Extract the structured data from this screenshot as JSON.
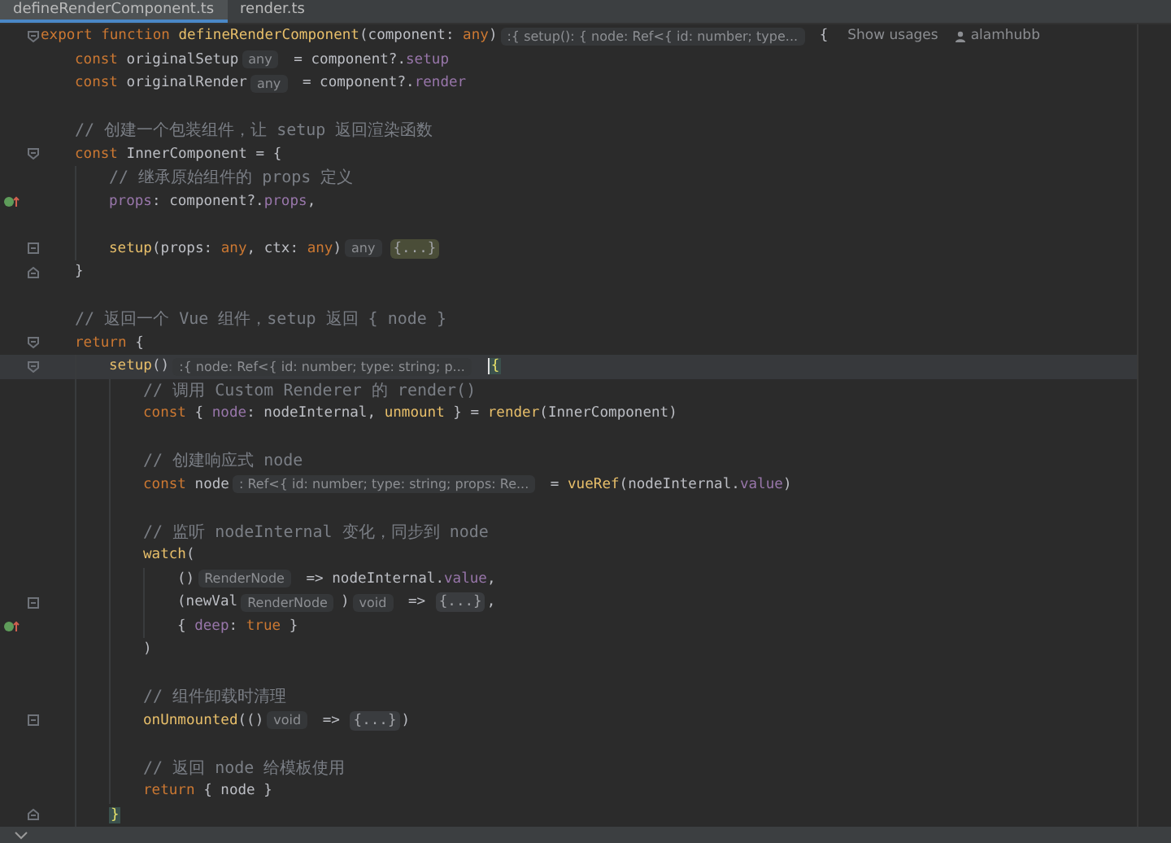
{
  "tabs": [
    {
      "label": "defineRenderComponent.ts",
      "selected": true
    },
    {
      "label": "render.ts",
      "selected": false
    }
  ],
  "lines": [
    {
      "kind": "code",
      "current": false,
      "gutter": {
        "kind": "fold"
      },
      "tokens": [
        {
          "kind": "kw",
          "text": "export function "
        },
        {
          "kind": "fn",
          "text": "defineRenderComponent"
        },
        {
          "kind": "plain",
          "text": "(component: "
        },
        {
          "kind": "kw",
          "text": "any"
        },
        {
          "kind": "plain",
          "text": ")"
        },
        {
          "kind": "hint",
          "text": ":{ setup(): { node: Ref<{ id: number; type..."
        },
        {
          "kind": "plain",
          "text": " {"
        },
        {
          "kind": "usages",
          "text": "Show usages"
        },
        {
          "kind": "author",
          "text": "alamhubb"
        }
      ],
      "children": [
        {
          "kind": "code",
          "current": false,
          "tokens": [
            {
              "kind": "kw",
              "text": "const "
            },
            {
              "kind": "plain",
              "text": "originalSetup"
            },
            {
              "kind": "hint",
              "text": "any"
            },
            {
              "kind": "plain",
              "text": " = component?."
            },
            {
              "kind": "prop",
              "text": "setup"
            }
          ]
        },
        {
          "kind": "code",
          "current": false,
          "tokens": [
            {
              "kind": "kw",
              "text": "const "
            },
            {
              "kind": "plain",
              "text": "originalRender"
            },
            {
              "kind": "hint",
              "text": "any"
            },
            {
              "kind": "plain",
              "text": " = component?."
            },
            {
              "kind": "prop",
              "text": "render"
            }
          ]
        },
        {
          "kind": "blank"
        },
        {
          "kind": "code",
          "current": false,
          "tokens": [
            {
              "kind": "comment",
              "text": "// 创建一个包装组件，让 setup 返回渲染函数"
            }
          ]
        },
        {
          "kind": "code",
          "current": false,
          "gutter": {
            "kind": "fold"
          },
          "tokens": [
            {
              "kind": "kw",
              "text": "const "
            },
            {
              "kind": "plain",
              "text": "InnerComponent = {"
            }
          ],
          "children": [
            {
              "kind": "code",
              "current": false,
              "tokens": [
                {
                  "kind": "comment",
                  "text": "// 继承原始组件的 props 定义"
                }
              ]
            },
            {
              "kind": "code",
              "current": false,
              "gutter": {
                "kind": "implement"
              },
              "tokens": [
                {
                  "kind": "prop",
                  "text": "props"
                },
                {
                  "kind": "plain",
                  "text": ": component?."
                },
                {
                  "kind": "prop",
                  "text": "props"
                },
                {
                  "kind": "plain",
                  "text": ","
                }
              ]
            },
            {
              "kind": "blank",
              "current": false
            },
            {
              "kind": "code",
              "current": false,
              "gutter": {
                "kind": "folded"
              },
              "tokens": [
                {
                  "kind": "fn",
                  "text": "setup"
                },
                {
                  "kind": "plain",
                  "text": "(props: "
                },
                {
                  "kind": "kw",
                  "text": "any"
                },
                {
                  "kind": "plain",
                  "text": ", ctx: "
                },
                {
                  "kind": "kw",
                  "text": "any"
                },
                {
                  "kind": "plain",
                  "text": ")"
                },
                {
                  "kind": "hint",
                  "text": "any"
                },
                {
                  "kind": "folded-hl",
                  "text": "{...}"
                }
              ]
            }
          ]
        },
        {
          "kind": "code",
          "current": false,
          "gutter": {
            "kind": "fold-end"
          },
          "tokens": [
            {
              "kind": "plain",
              "text": "}"
            }
          ]
        },
        {
          "kind": "blank"
        },
        {
          "kind": "code",
          "current": false,
          "tokens": [
            {
              "kind": "comment",
              "text": "// 返回一个 Vue 组件，setup 返回 { node }"
            }
          ]
        },
        {
          "kind": "code",
          "current": false,
          "gutter": {
            "kind": "fold"
          },
          "tokens": [
            {
              "kind": "kw",
              "text": "return"
            },
            {
              "kind": "plain",
              "text": " {"
            }
          ],
          "children": [
            {
              "kind": "code",
              "current": true,
              "gutter": {
                "kind": "fold"
              },
              "tokens": [
                {
                  "kind": "fn",
                  "text": "setup"
                },
                {
                  "kind": "plain",
                  "text": "()"
                },
                {
                  "kind": "hint",
                  "text": ":{ node: Ref<{ id: number; type: string; p..."
                },
                {
                  "kind": "brace-cursor",
                  "text": "{"
                }
              ],
              "children": [
                {
                  "kind": "code",
                  "current": false,
                  "tokens": [
                    {
                      "kind": "comment",
                      "text": "// 调用 Custom Renderer 的 render()"
                    }
                  ]
                },
                {
                  "kind": "code",
                  "current": false,
                  "tokens": [
                    {
                      "kind": "kw",
                      "text": "const "
                    },
                    {
                      "kind": "plain",
                      "text": "{ "
                    },
                    {
                      "kind": "prop",
                      "text": "node"
                    },
                    {
                      "kind": "plain",
                      "text": ": nodeInternal, "
                    },
                    {
                      "kind": "fn",
                      "text": "unmount"
                    },
                    {
                      "kind": "plain",
                      "text": " } = "
                    },
                    {
                      "kind": "fn",
                      "text": "render"
                    },
                    {
                      "kind": "plain",
                      "text": "(InnerComponent)"
                    }
                  ]
                },
                {
                  "kind": "blank",
                  "current": false
                },
                {
                  "kind": "code",
                  "current": false,
                  "tokens": [
                    {
                      "kind": "comment",
                      "text": "// 创建响应式 node"
                    }
                  ]
                },
                {
                  "kind": "code",
                  "current": false,
                  "tokens": [
                    {
                      "kind": "kw",
                      "text": "const "
                    },
                    {
                      "kind": "plain",
                      "text": "node"
                    },
                    {
                      "kind": "hint",
                      "text": ": Ref<{ id: number; type: string; props: Re..."
                    },
                    {
                      "kind": "plain",
                      "text": " = "
                    },
                    {
                      "kind": "fn",
                      "text": "vueRef"
                    },
                    {
                      "kind": "plain",
                      "text": "(nodeInternal."
                    },
                    {
                      "kind": "prop",
                      "text": "value"
                    },
                    {
                      "kind": "plain",
                      "text": ")"
                    }
                  ]
                },
                {
                  "kind": "blank",
                  "current": false
                },
                {
                  "kind": "code",
                  "current": false,
                  "tokens": [
                    {
                      "kind": "comment",
                      "text": "// 监听 nodeInternal 变化，同步到 node"
                    }
                  ]
                },
                {
                  "kind": "code",
                  "current": false,
                  "tokens": [
                    {
                      "kind": "fn",
                      "text": "watch"
                    },
                    {
                      "kind": "plain",
                      "text": "("
                    }
                  ],
                  "children": [
                    {
                      "kind": "code",
                      "current": false,
                      "tokens": [
                        {
                          "kind": "plain",
                          "text": "()"
                        },
                        {
                          "kind": "hint",
                          "text": "RenderNode"
                        },
                        {
                          "kind": "plain",
                          "text": " => nodeInternal."
                        },
                        {
                          "kind": "prop",
                          "text": "value"
                        },
                        {
                          "kind": "plain",
                          "text": ","
                        }
                      ]
                    },
                    {
                      "kind": "code",
                      "current": false,
                      "gutter": {
                        "kind": "folded"
                      },
                      "tokens": [
                        {
                          "kind": "plain",
                          "text": "(newVal"
                        },
                        {
                          "kind": "hint",
                          "text": "RenderNode"
                        },
                        {
                          "kind": "plain",
                          "text": ")"
                        },
                        {
                          "kind": "hint",
                          "text": "void"
                        },
                        {
                          "kind": "plain",
                          "text": " => "
                        },
                        {
                          "kind": "folded",
                          "text": "{...}"
                        },
                        {
                          "kind": "plain",
                          "text": ","
                        }
                      ]
                    },
                    {
                      "kind": "code",
                      "current": false,
                      "gutter": {
                        "kind": "implement"
                      },
                      "tokens": [
                        {
                          "kind": "plain",
                          "text": "{ "
                        },
                        {
                          "kind": "prop",
                          "text": "deep"
                        },
                        {
                          "kind": "plain",
                          "text": ": "
                        },
                        {
                          "kind": "kw",
                          "text": "true"
                        },
                        {
                          "kind": "plain",
                          "text": " }"
                        }
                      ]
                    }
                  ]
                },
                {
                  "kind": "code",
                  "current": false,
                  "tokens": [
                    {
                      "kind": "plain",
                      "text": ")"
                    }
                  ]
                },
                {
                  "kind": "blank",
                  "current": false
                },
                {
                  "kind": "code",
                  "current": false,
                  "tokens": [
                    {
                      "kind": "comment",
                      "text": "// 组件卸载时清理"
                    }
                  ]
                },
                {
                  "kind": "code",
                  "current": false,
                  "gutter": {
                    "kind": "folded"
                  },
                  "tokens": [
                    {
                      "kind": "fn",
                      "text": "onUnmounted"
                    },
                    {
                      "kind": "plain",
                      "text": "(()"
                    },
                    {
                      "kind": "hint",
                      "text": "void"
                    },
                    {
                      "kind": "plain",
                      "text": " => "
                    },
                    {
                      "kind": "folded",
                      "text": "{...}"
                    },
                    {
                      "kind": "plain",
                      "text": ")"
                    }
                  ]
                },
                {
                  "kind": "blank",
                  "current": false
                },
                {
                  "kind": "code",
                  "current": false,
                  "tokens": [
                    {
                      "kind": "comment",
                      "text": "// 返回 node 给模板使用"
                    }
                  ]
                },
                {
                  "kind": "code",
                  "current": false,
                  "tokens": [
                    {
                      "kind": "kw",
                      "text": "return"
                    },
                    {
                      "kind": "plain",
                      "text": " { node }"
                    }
                  ]
                }
              ]
            },
            {
              "kind": "code",
              "current": false,
              "gutter": {
                "kind": "fold-end"
              },
              "tokens": [
                {
                  "kind": "brace",
                  "text": "}"
                }
              ]
            }
          ]
        }
      ]
    }
  ]
}
